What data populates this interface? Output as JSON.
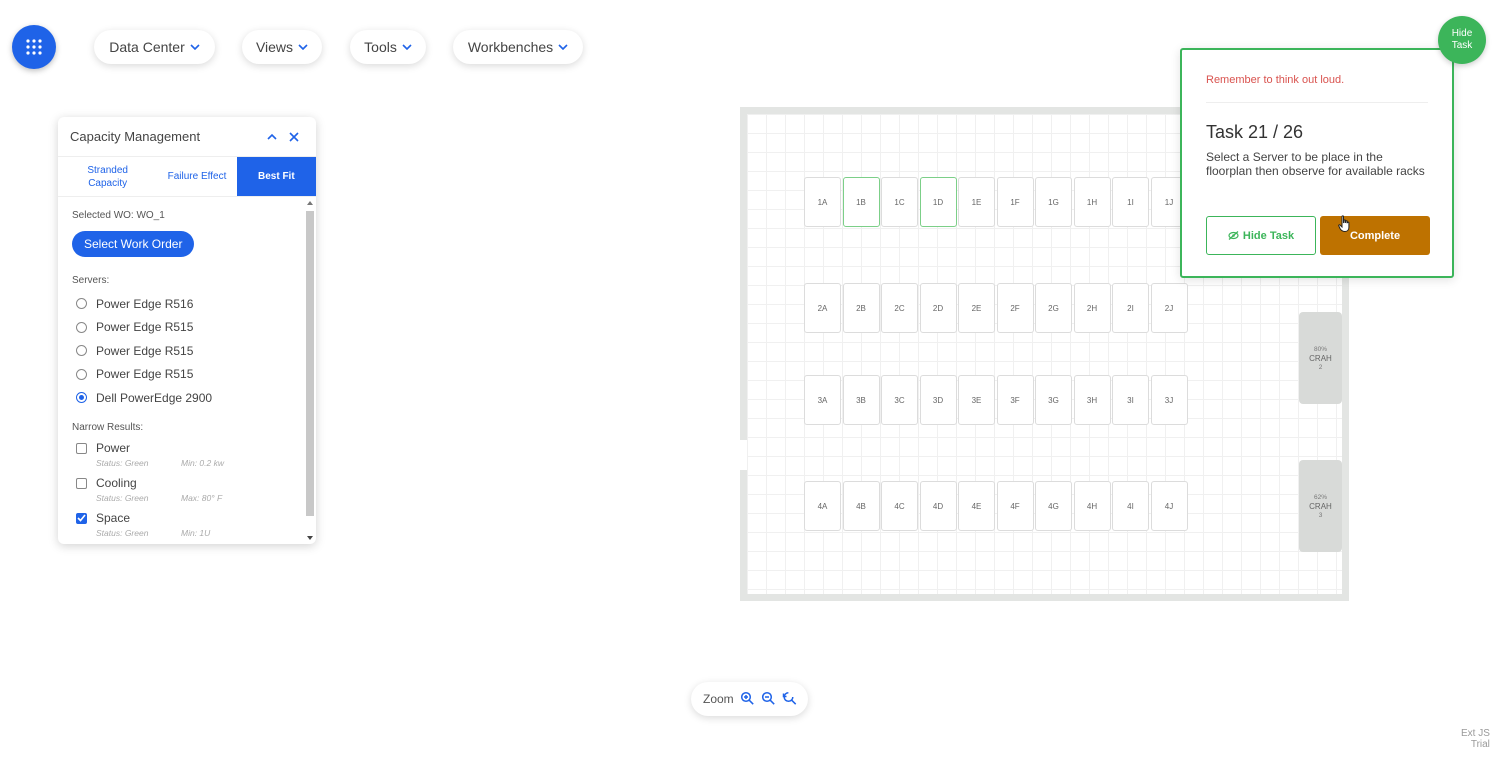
{
  "nav": {
    "app_menu": "apps-grid-icon",
    "items": [
      {
        "label": "Data Center"
      },
      {
        "label": "Views"
      },
      {
        "label": "Tools"
      },
      {
        "label": "Workbenches"
      }
    ]
  },
  "panel": {
    "title": "Capacity Management",
    "tabs": [
      {
        "label": "Stranded Capacity",
        "active": false
      },
      {
        "label": "Failure Effect",
        "active": false
      },
      {
        "label": "Best Fit",
        "active": true
      }
    ],
    "selected_wo": "Selected WO: WO_1",
    "select_wo_button": "Select Work Order",
    "servers_label": "Servers:",
    "servers": [
      {
        "label": "Power Edge R516",
        "checked": false
      },
      {
        "label": "Power Edge R515",
        "checked": false
      },
      {
        "label": "Power Edge R515",
        "checked": false
      },
      {
        "label": "Power Edge R515",
        "checked": false
      },
      {
        "label": "Dell PowerEdge 2900",
        "checked": true
      }
    ],
    "narrow_label": "Narrow Results:",
    "filters": [
      {
        "label": "Power",
        "status": "Status: Green",
        "limit": "Min: 0.2 kw",
        "checked": false
      },
      {
        "label": "Cooling",
        "status": "Status: Green",
        "limit": "Max: 80° F",
        "checked": false
      },
      {
        "label": "Space",
        "status": "Status: Green",
        "limit": "Min: 1U",
        "checked": true
      }
    ]
  },
  "floorplan": {
    "rows": [
      [
        "1A",
        "1B",
        "1C",
        "1D",
        "1E",
        "1F",
        "1G",
        "1H",
        "1I",
        "1J"
      ],
      [
        "2A",
        "2B",
        "2C",
        "2D",
        "2E",
        "2F",
        "2G",
        "2H",
        "2I",
        "2J"
      ],
      [
        "3A",
        "3B",
        "3C",
        "3D",
        "3E",
        "3F",
        "3G",
        "3H",
        "3I",
        "3J"
      ],
      [
        "4A",
        "4B",
        "4C",
        "4D",
        "4E",
        "4F",
        "4G",
        "4H",
        "4I",
        "4J"
      ]
    ],
    "highlighted": [
      "1B",
      "1D"
    ],
    "crahs": [
      {
        "percent": "80%",
        "name": "CRAH",
        "number": "2"
      },
      {
        "percent": "62%",
        "name": "CRAH",
        "number": "3"
      }
    ]
  },
  "task": {
    "note": "Remember to think out loud.",
    "title": "Task 21 / 26",
    "description": "Select a Server to be place in the floorplan then observe for available racks",
    "hide_button": "Hide Task",
    "complete_button": "Complete",
    "hide_circle": "Hide Task"
  },
  "zoom": {
    "label": "Zoom"
  },
  "watermark": {
    "line1": "Ext JS",
    "line2": "Trial"
  },
  "colors": {
    "primary": "#1f63e8",
    "success": "#3cb55a",
    "complete": "#be7200",
    "note": "#d9534f"
  }
}
